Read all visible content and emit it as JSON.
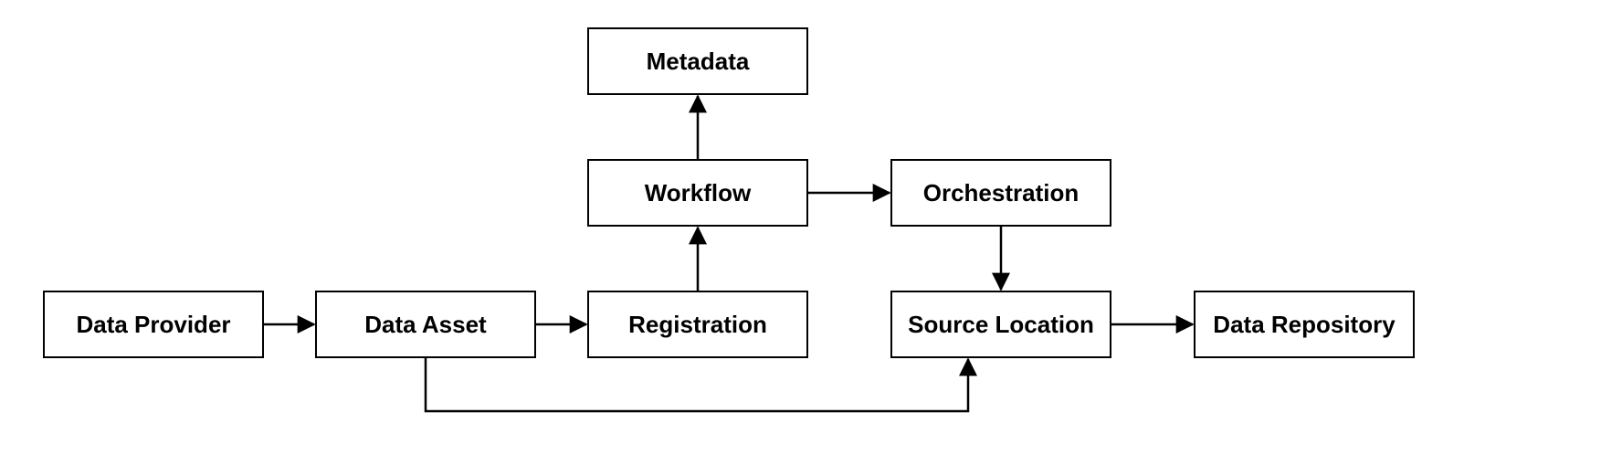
{
  "diagram": {
    "nodes": {
      "data_provider": {
        "label": "Data Provider"
      },
      "data_asset": {
        "label": "Data Asset"
      },
      "registration": {
        "label": "Registration"
      },
      "workflow": {
        "label": "Workflow"
      },
      "metadata": {
        "label": "Metadata"
      },
      "orchestration": {
        "label": "Orchestration"
      },
      "source_location": {
        "label": "Source Location"
      },
      "data_repository": {
        "label": "Data Repository"
      }
    },
    "edges": [
      {
        "from": "data_provider",
        "to": "data_asset"
      },
      {
        "from": "data_asset",
        "to": "registration"
      },
      {
        "from": "registration",
        "to": "workflow"
      },
      {
        "from": "workflow",
        "to": "metadata"
      },
      {
        "from": "workflow",
        "to": "orchestration"
      },
      {
        "from": "orchestration",
        "to": "source_location"
      },
      {
        "from": "data_asset",
        "to": "source_location"
      },
      {
        "from": "source_location",
        "to": "data_repository"
      }
    ]
  }
}
